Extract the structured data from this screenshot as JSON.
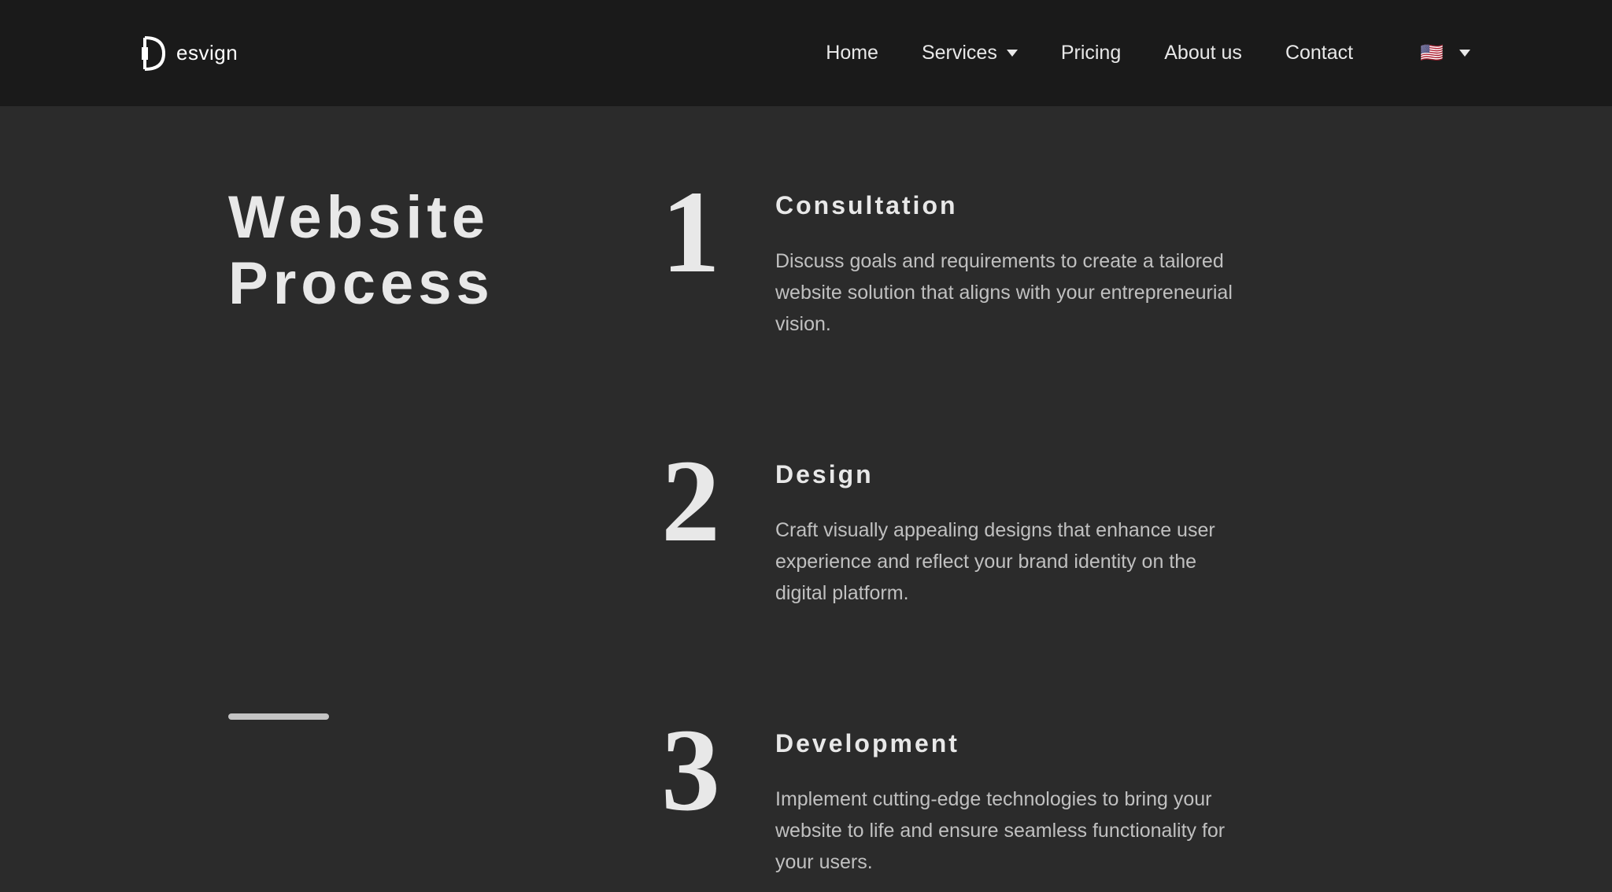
{
  "header": {
    "logo_text": "esvign",
    "nav": {
      "home": "Home",
      "services": "Services",
      "pricing": "Pricing",
      "about": "About us",
      "contact": "Contact"
    },
    "lang_flag": "🇺🇸"
  },
  "main": {
    "title_line1": "Website",
    "title_line2": "Process",
    "steps": [
      {
        "number": "1",
        "title": "Consultation",
        "description": "Discuss goals and requirements to create a tailored website solution that aligns with your entrepreneurial vision."
      },
      {
        "number": "2",
        "title": "Design",
        "description": "Craft visually appealing designs that enhance user experience and reflect your brand identity on the digital platform."
      },
      {
        "number": "3",
        "title": "Development",
        "description": "Implement cutting-edge technologies to bring your website to life and ensure seamless functionality for your users."
      }
    ]
  }
}
